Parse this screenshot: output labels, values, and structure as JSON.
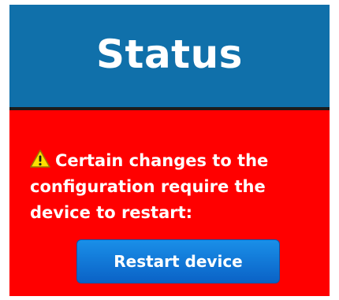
{
  "header": {
    "title": "Status"
  },
  "alert": {
    "icon": "warning-icon",
    "message": "Certain changes to the configuration require the device to restart:",
    "button_label": "Restart device"
  },
  "colors": {
    "header_bg": "#1070aa",
    "alert_bg": "#ff0000",
    "button_bg": "#0a74d8",
    "text": "#ffffff"
  }
}
